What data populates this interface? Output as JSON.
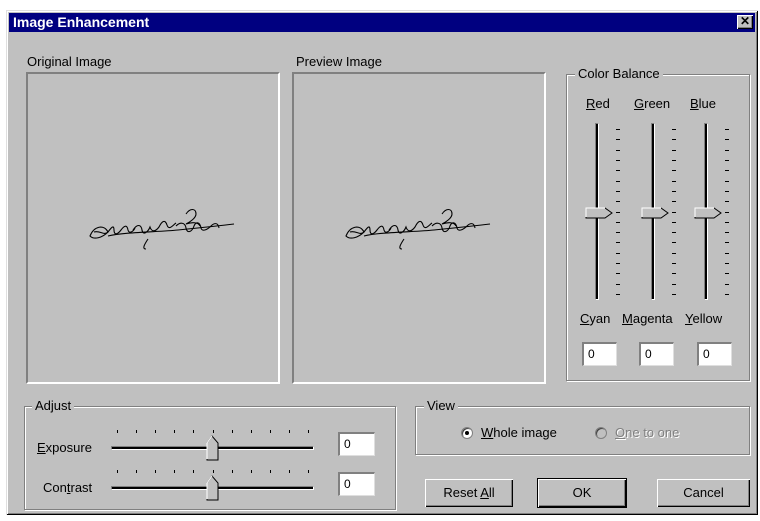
{
  "dialog": {
    "title": "Image Enhancement",
    "close_label": "✕"
  },
  "original_image": {
    "label": "Original Image"
  },
  "preview_image": {
    "label": "Preview Image"
  },
  "color_balance": {
    "legend": "Color Balance",
    "channels": [
      {
        "top_first": "R",
        "top_rest": "ed",
        "bottom_first": "C",
        "bottom_rest": "yan",
        "value": "0",
        "level": 0.5
      },
      {
        "top_first": "G",
        "top_rest": "reen",
        "bottom_first": "M",
        "bottom_rest": "agenta",
        "value": "0",
        "level": 0.5
      },
      {
        "top_first": "B",
        "top_rest": "lue",
        "bottom_first": "Y",
        "bottom_rest": "ellow",
        "value": "0",
        "level": 0.5
      }
    ]
  },
  "adjust": {
    "legend": "Adjust",
    "exposure": {
      "label_first": "E",
      "label_rest": "xposure",
      "value": "0",
      "level": 0.5
    },
    "contrast": {
      "label_pre": "Con",
      "label_u": "t",
      "label_rest": "rast",
      "value": "0",
      "level": 0.5
    }
  },
  "view": {
    "legend": "View",
    "whole_image": {
      "label_first": "W",
      "label_rest": "hole image",
      "selected": true
    },
    "one_to_one": {
      "label_first": "O",
      "label_rest": "ne to one",
      "enabled": false
    }
  },
  "buttons": {
    "reset_pre": "Reset ",
    "reset_u": "A",
    "reset_rest": "ll",
    "ok": "OK",
    "cancel": "Cancel"
  }
}
